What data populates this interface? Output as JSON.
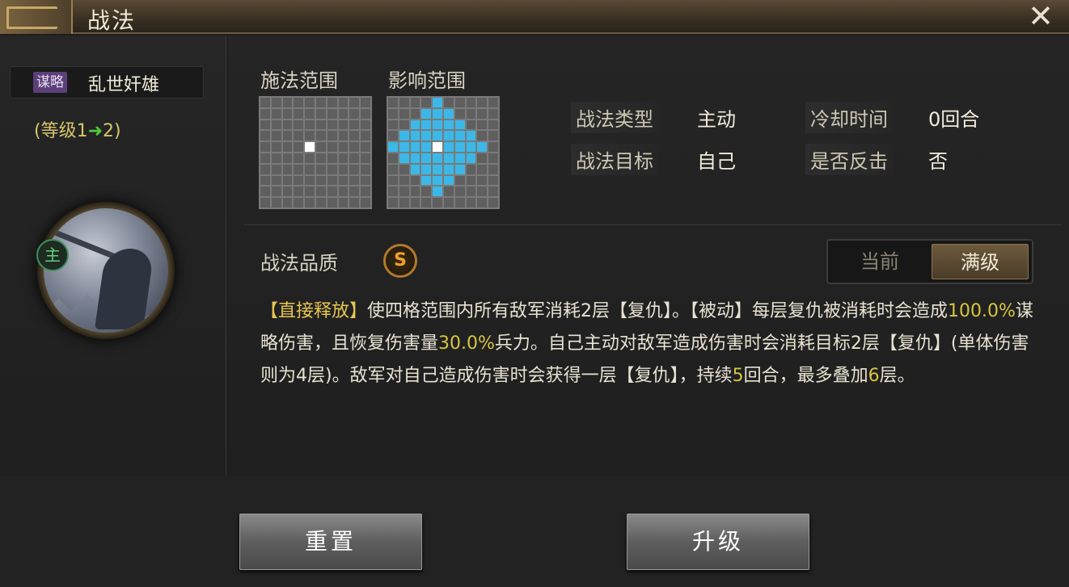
{
  "window": {
    "title": "战法",
    "close": "✕"
  },
  "skill": {
    "type_tag": "谋略",
    "name": "乱世奸雄",
    "level_prefix": "(等级1",
    "level_arrow": "➜",
    "level_suffix": "2)",
    "badge": "主"
  },
  "ranges": {
    "cast_label": "施法范围",
    "effect_label": "影响范围"
  },
  "attributes": {
    "type_label": "战法类型",
    "type_value": "主动",
    "cooldown_label": "冷却时间",
    "cooldown_value": "0回合",
    "target_label": "战法目标",
    "target_value": "自己",
    "counter_label": "是否反击",
    "counter_value": "否"
  },
  "quality": {
    "label": "战法品质",
    "grade": "S"
  },
  "toggle": {
    "current": "当前",
    "max": "满级"
  },
  "description": {
    "p1": "【直接释放】",
    "p2": "使四格范围内所有敌军消耗2层【复仇】。【被动】每层复仇被消耗时会造成",
    "p3": "100.0%",
    "p4": "谋略伤害，且恢复伤害量",
    "p5": "30.0%",
    "p6": "兵力。自己主动对敌军造成伤害时会消耗目标2层【复仇】(单体伤害则为4层)。敌军对自己造成伤害时会获得一层【复仇】，持续",
    "p7": "5",
    "p8": "回合，最多叠加",
    "p9": "6",
    "p10": "层。"
  },
  "buttons": {
    "reset": "重置",
    "upgrade": "升级"
  },
  "colors": {
    "highlight": "#e8c650",
    "range_fill": "#3bb8e8",
    "accent_gold": "#b07a2a"
  }
}
